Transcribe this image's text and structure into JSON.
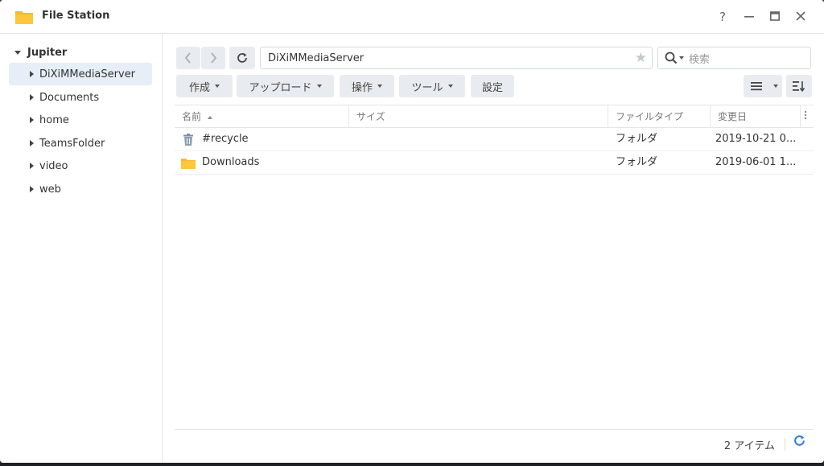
{
  "window": {
    "title": "File Station",
    "controls": {
      "help": "?",
      "minimize": "—",
      "maximize": "▭",
      "close": "✕"
    }
  },
  "sidebar": {
    "root": "Jupiter",
    "items": [
      {
        "label": "DiXiMMediaServer",
        "selected": true
      },
      {
        "label": "Documents",
        "selected": false
      },
      {
        "label": "home",
        "selected": false
      },
      {
        "label": "TeamsFolder",
        "selected": false
      },
      {
        "label": "video",
        "selected": false
      },
      {
        "label": "web",
        "selected": false
      }
    ]
  },
  "toolbar": {
    "back_icon": "chevron-left-icon",
    "forward_icon": "chevron-right-icon",
    "refresh_icon": "refresh-icon",
    "path": "DiXiMMediaServer",
    "search_placeholder": "検索",
    "buttons": {
      "create": "作成",
      "upload": "アップロード",
      "action": "操作",
      "tools": "ツール",
      "settings": "設定"
    }
  },
  "table": {
    "columns": {
      "name": "名前",
      "size": "サイズ",
      "type": "ファイルタイプ",
      "modified": "変更日"
    },
    "rows": [
      {
        "icon": "recycle-bin-icon",
        "name": "#recycle",
        "size": "",
        "type": "フォルダ",
        "modified": "2019-10-21 0..."
      },
      {
        "icon": "folder-icon",
        "name": "Downloads",
        "size": "",
        "type": "フォルダ",
        "modified": "2019-06-01 1..."
      }
    ]
  },
  "footer": {
    "count": "2 アイテム"
  },
  "colors": {
    "accent": "#2f7dd9",
    "selected_bg": "#e6eef8",
    "button_bg": "#e8ecf0",
    "folder": "#f7b928"
  }
}
